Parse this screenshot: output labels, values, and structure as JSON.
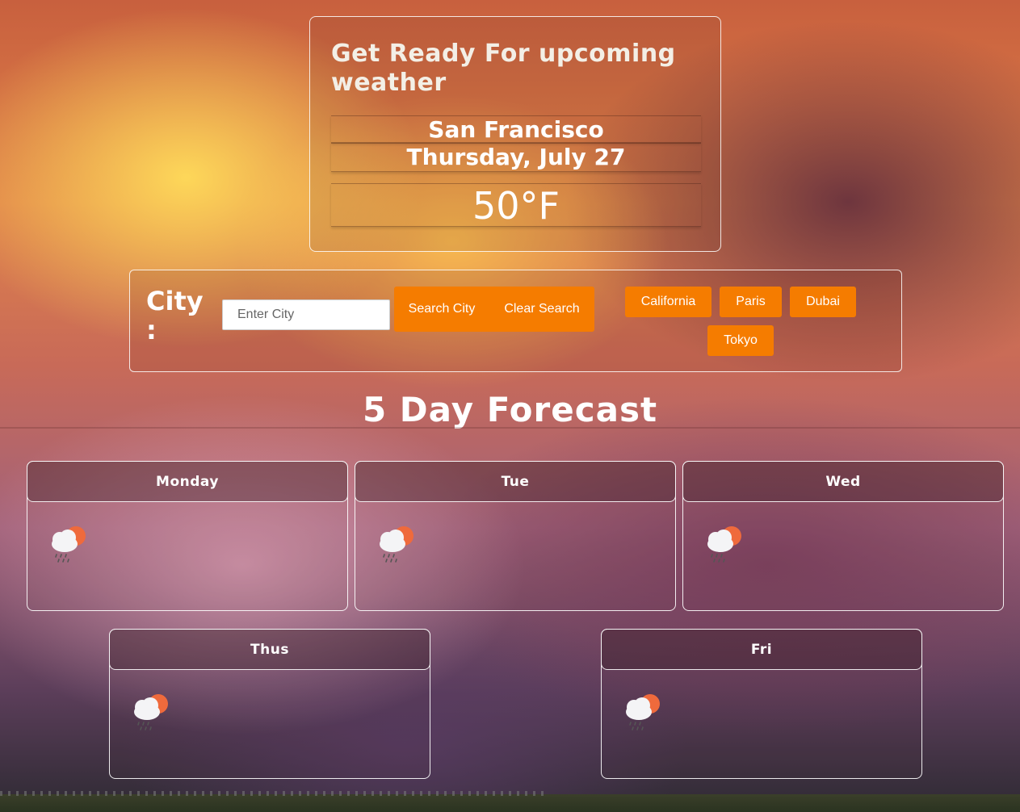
{
  "header": {
    "title": "Get Ready For upcoming weather",
    "city": "San Francisco",
    "date": "Thursday, July 27",
    "temperature": "50°F"
  },
  "search": {
    "label": "City :",
    "placeholder": "Enter City",
    "search_button": "Search City",
    "clear_button": "Clear Search",
    "quick_cities": [
      "California",
      "Paris",
      "Dubai",
      "Tokyo"
    ]
  },
  "forecast": {
    "title": "5 Day Forecast",
    "days": [
      {
        "label": "Monday",
        "icon": "rain-cloud-sun-icon"
      },
      {
        "label": "Tue",
        "icon": "rain-cloud-sun-icon"
      },
      {
        "label": "Wed",
        "icon": "rain-cloud-sun-icon"
      },
      {
        "label": "Thus",
        "icon": "rain-cloud-sun-icon"
      },
      {
        "label": "Fri",
        "icon": "rain-cloud-sun-icon"
      }
    ]
  },
  "colors": {
    "accent": "#f57c00",
    "text": "#ffffff"
  }
}
